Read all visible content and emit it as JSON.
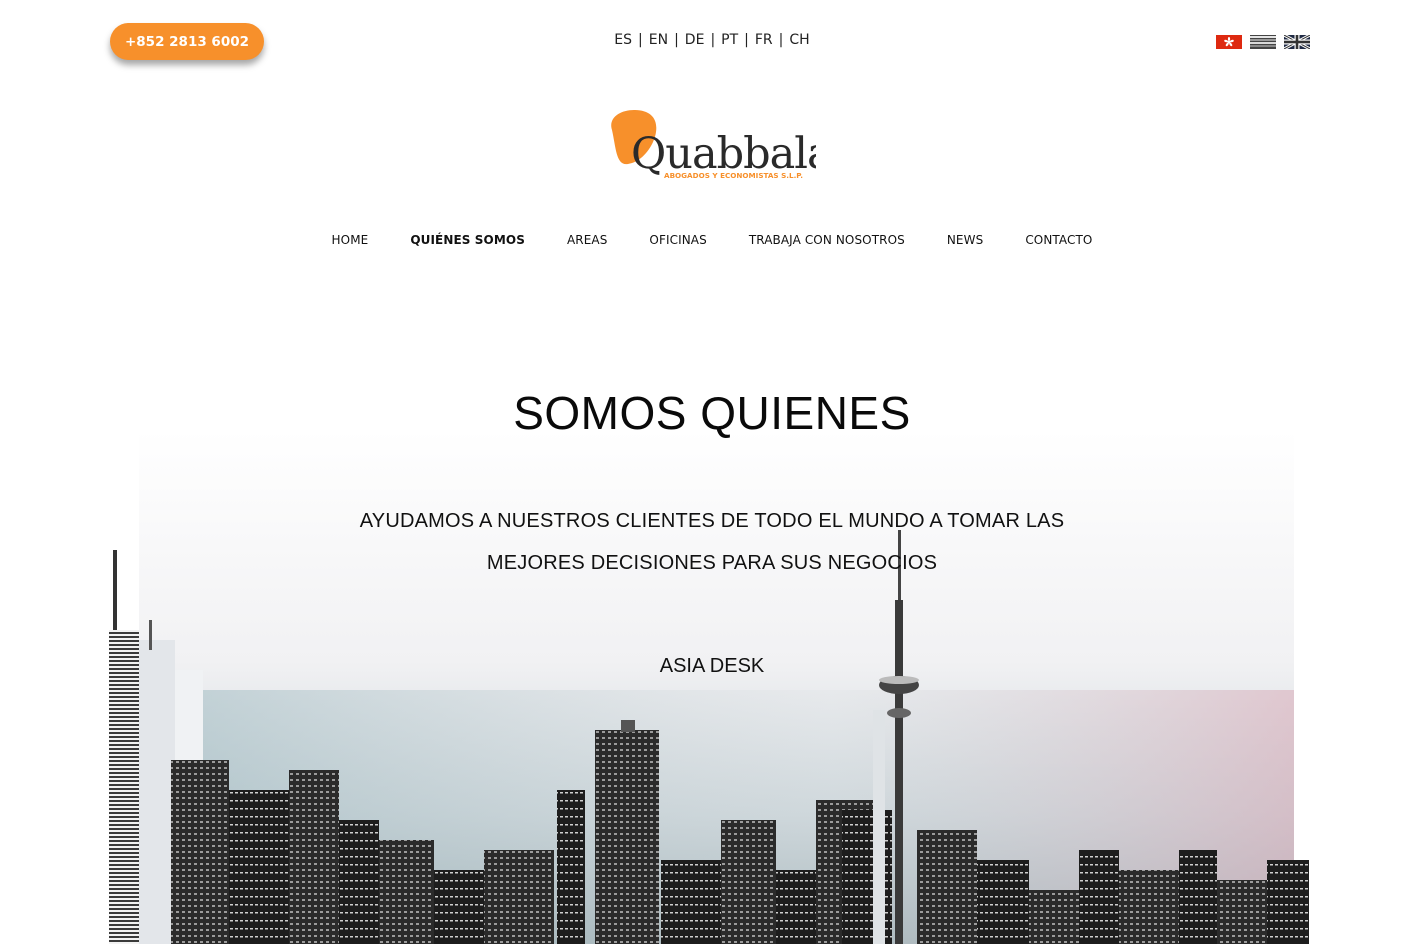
{
  "topbar": {
    "phone": "+852 2813 6002",
    "languages": [
      "ES",
      "EN",
      "DE",
      "PT",
      "FR",
      "CH"
    ],
    "separator": "|",
    "flags": [
      "hong-kong-flag",
      "generic-flag",
      "uk-flag"
    ]
  },
  "logo": {
    "name": "Quabbala",
    "tagline": "ABOGADOS Y ECONOMISTAS S.L.P.",
    "accent_color": "#f7902b"
  },
  "nav": {
    "items": [
      "HOME",
      "QUIÉNES SOMOS",
      "AREAS",
      "OFICINAS",
      "TRABAJA CON NOSOTROS",
      "NEWS",
      "CONTACTO"
    ],
    "active": "QUIÉNES SOMOS"
  },
  "hero": {
    "title": "SOMOS QUIENES",
    "subtitle_line1": "AYUDAMOS A NUESTROS CLIENTES DE TODO EL MUNDO A TOMAR LAS",
    "subtitle_line2": "MEJORES DECISIONES PARA SUS NEGOCIOS",
    "link": "ASIA DESK"
  }
}
